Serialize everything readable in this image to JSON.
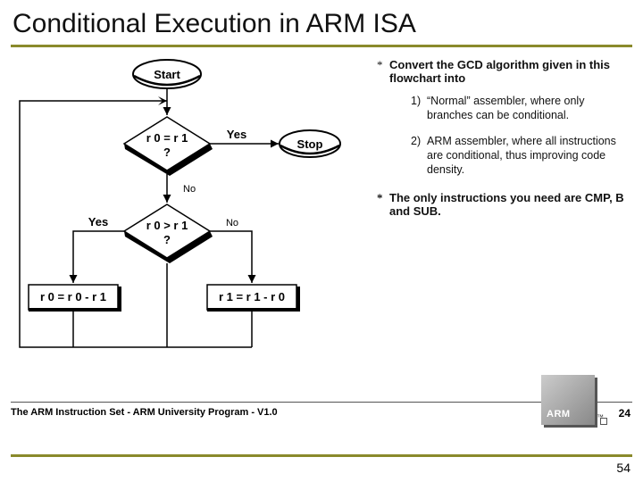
{
  "title": "Conditional Execution in ARM ISA",
  "flow": {
    "start": "Start",
    "stop": "Stop",
    "d1_top": "r 0 = r 1",
    "d1_bot": "?",
    "d2_top": "r 0 > r 1",
    "d2_bot": "?",
    "yes": "Yes",
    "no": "No",
    "boxL": "r 0 = r 0 - r 1",
    "boxR": "r 1 = r 1 - r 0"
  },
  "rhs": {
    "lead": "Convert the GCD algorithm given in this flowchart into",
    "i1_num": "1)",
    "i1": "“Normal” assembler, where only branches can be conditional.",
    "i2_num": "2)",
    "i2": "ARM assembler, where all instructions are conditional, thus improving code density.",
    "closing": "The only instructions you need are CMP, B and SUB."
  },
  "footer": "The ARM Instruction Set - ARM University Program - V1.0",
  "badge": "ARM",
  "pg_inner": "24",
  "page": "54"
}
